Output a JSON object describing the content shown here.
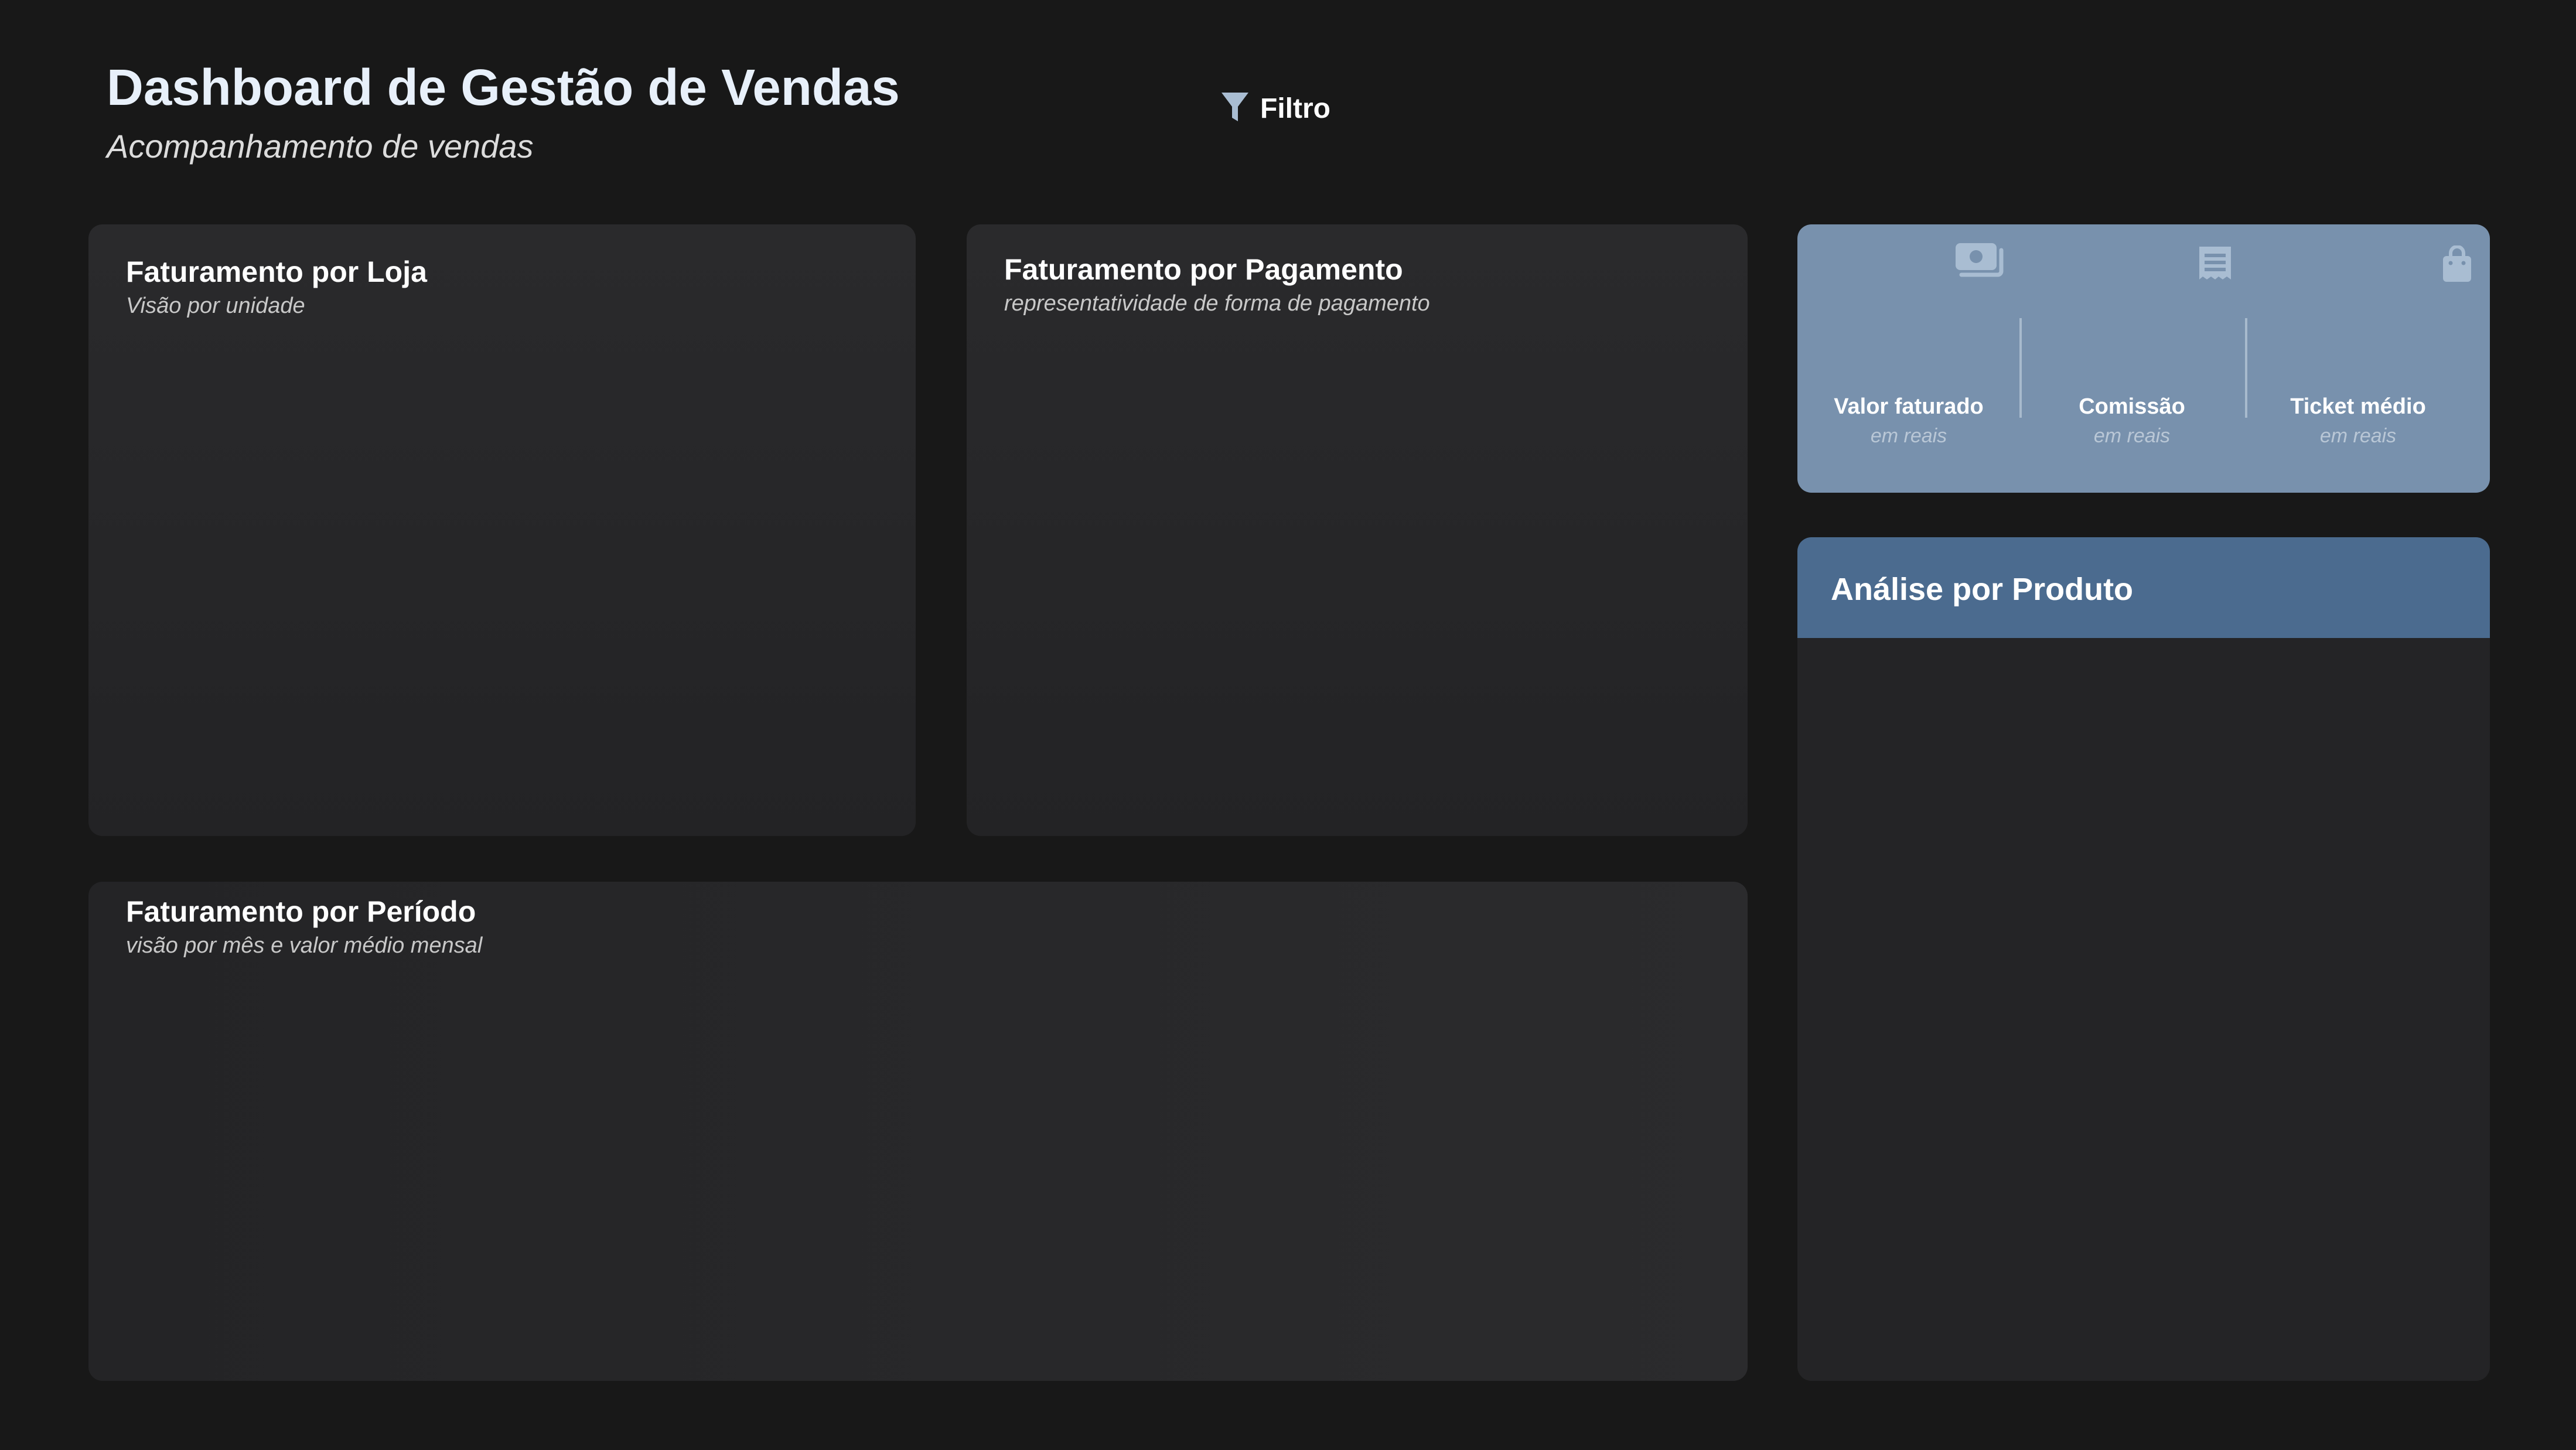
{
  "header": {
    "title": "Dashboard de Gestão de Vendas",
    "subtitle": "Acompanhamento de vendas"
  },
  "filter": {
    "label": "Filtro",
    "icon": "filter-icon"
  },
  "cards": {
    "loja": {
      "title": "Faturamento por Loja",
      "subtitle": "Visão por unidade"
    },
    "pagamento": {
      "title": "Faturamento por Pagamento",
      "subtitle": "representatividade de forma de pagamento"
    },
    "periodo": {
      "title": "Faturamento por Período",
      "subtitle": "visão por mês e valor médio mensal"
    }
  },
  "kpis": [
    {
      "label": "Valor faturado",
      "sub": "em reais",
      "icon": "money-icon"
    },
    {
      "label": "Comissão",
      "sub": "em reais",
      "icon": "receipt-icon"
    },
    {
      "label": "Ticket médio",
      "sub": "em reais",
      "icon": "shopping-bag-icon"
    }
  ],
  "product_panel": {
    "title": "Análise por Produto"
  },
  "colors": {
    "background": "#181818",
    "card": "#2a2a2c",
    "kpi_panel": "#7891ad",
    "product_header": "#4b6b8f",
    "icon": "#a9bdd2"
  }
}
